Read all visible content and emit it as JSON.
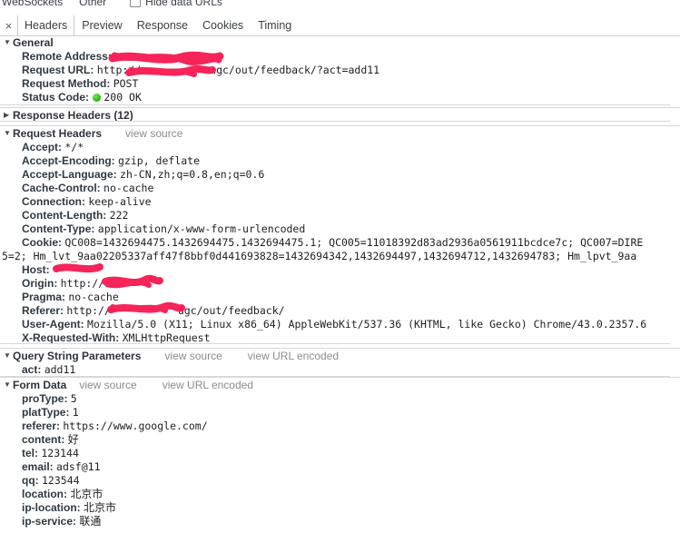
{
  "filter_bar": {
    "items": [
      "WebSockets",
      "Other"
    ],
    "hide_data_urls_label": "Hide data URLs",
    "hide_data_urls_checked": false
  },
  "tabs": {
    "close_label": "×",
    "items": [
      {
        "label": "Headers",
        "active": true
      },
      {
        "label": "Preview",
        "active": false
      },
      {
        "label": "Response",
        "active": false
      },
      {
        "label": "Cookies",
        "active": false
      },
      {
        "label": "Timing",
        "active": false
      }
    ]
  },
  "sections": {
    "general": {
      "title": "General",
      "expanded": true,
      "rows": [
        {
          "key": "Remote Address:",
          "value": "",
          "redacted": true
        },
        {
          "key": "Request URL:",
          "value": "http://",
          "value_tail": "ugc/out/feedback/?act=add11",
          "redacted": true
        },
        {
          "key": "Request Method:",
          "value": "POST"
        },
        {
          "key": "Status Code:",
          "value": "200 OK",
          "status_dot": true
        }
      ]
    },
    "response_headers": {
      "title": "Response Headers (12)",
      "expanded": false
    },
    "request_headers": {
      "title": "Request Headers",
      "view_source": "view source",
      "expanded": true,
      "rows": [
        {
          "key": "Accept:",
          "value": "*/*"
        },
        {
          "key": "Accept-Encoding:",
          "value": "gzip, deflate"
        },
        {
          "key": "Accept-Language:",
          "value": "zh-CN,zh;q=0.8,en;q=0.6"
        },
        {
          "key": "Cache-Control:",
          "value": "no-cache"
        },
        {
          "key": "Connection:",
          "value": "keep-alive"
        },
        {
          "key": "Content-Length:",
          "value": "222"
        },
        {
          "key": "Content-Type:",
          "value": "application/x-www-form-urlencoded"
        },
        {
          "key": "Cookie:",
          "value": "QC008=1432694475.1432694475.1432694475.1; QC005=11018392d83ad2936a0561911bcdce7c; QC007=DIRE",
          "value_line2": "5=2; Hm_lvt_9aa02205337aff47f8bbf0d441693828=1432694342,1432694497,1432694712,1432694783; Hm_lpvt_9aa"
        },
        {
          "key": "Host:",
          "value": "",
          "redacted": true
        },
        {
          "key": "Origin:",
          "value": "http://",
          "redacted": true
        },
        {
          "key": "Pragma:",
          "value": "no-cache"
        },
        {
          "key": "Referer:",
          "value": "http://",
          "value_tail": "ugc/out/feedback/",
          "redacted": true
        },
        {
          "key": "User-Agent:",
          "value": "Mozilla/5.0 (X11; Linux x86_64) AppleWebKit/537.36 (KHTML, like Gecko) Chrome/43.0.2357.6"
        },
        {
          "key": "X-Requested-With:",
          "value": "XMLHttpRequest"
        }
      ]
    },
    "query_string": {
      "title": "Query String Parameters",
      "view_source": "view source",
      "view_url_encoded": "view URL encoded",
      "expanded": true,
      "rows": [
        {
          "key": "act:",
          "value": "add11"
        }
      ]
    },
    "form_data": {
      "title": "Form Data",
      "view_source": "view source",
      "view_url_encoded": "view URL encoded",
      "expanded": true,
      "rows": [
        {
          "key": "proType:",
          "value": "5"
        },
        {
          "key": "platType:",
          "value": "1"
        },
        {
          "key": "referer:",
          "value": "https://www.google.com/"
        },
        {
          "key": "content:",
          "value": "好",
          "cjk": true
        },
        {
          "key": "tel:",
          "value": "123144"
        },
        {
          "key": "email:",
          "value": "adsf@11"
        },
        {
          "key": "qq:",
          "value": "123544"
        },
        {
          "key": "location:",
          "value": "北京市",
          "cjk": true
        },
        {
          "key": "ip-location:",
          "value": "北京市",
          "cjk": true
        },
        {
          "key": "ip-service:",
          "value": "联通",
          "cjk": true
        }
      ]
    }
  },
  "colors": {
    "redaction": "#f62459",
    "status_ok": "#2ec10c",
    "link_gray": "#8c8c8c",
    "divider": "#d8d8d8"
  }
}
